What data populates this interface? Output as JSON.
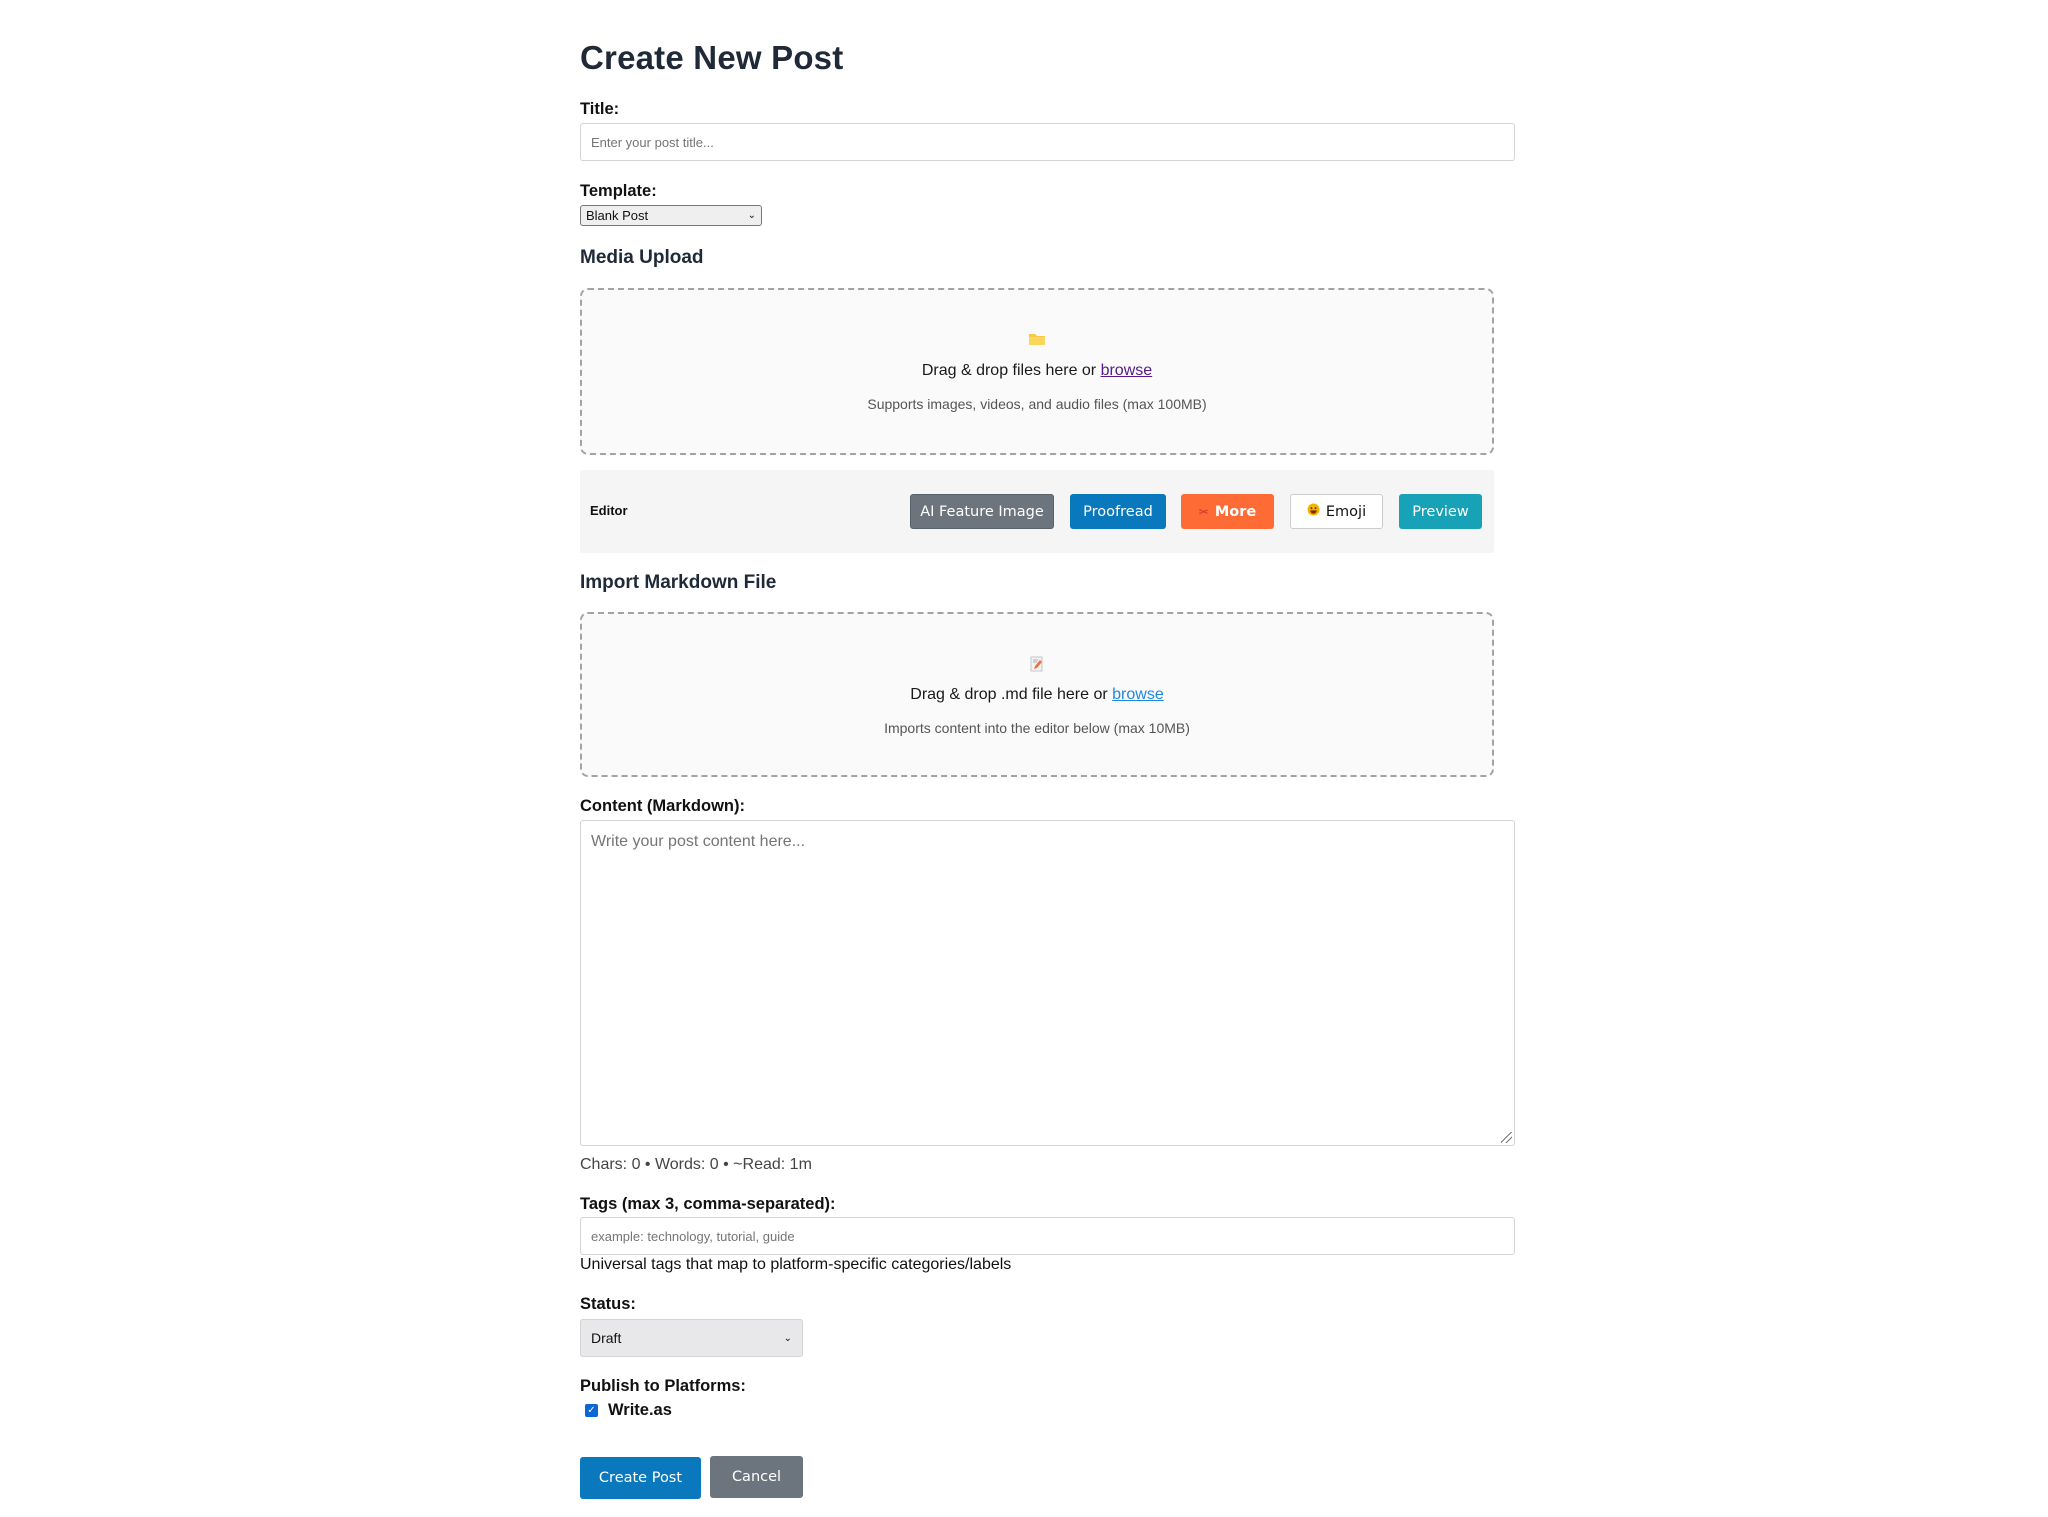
{
  "page_title": "Create New Post",
  "title_field": {
    "label": "Title:",
    "placeholder": "Enter your post title..."
  },
  "template": {
    "label": "Template:",
    "selected": "Blank Post"
  },
  "media_upload": {
    "heading": "Media Upload",
    "icon": "folder-icon",
    "main_text": "Drag & drop files here or ",
    "link": "browse",
    "hint": "Supports images, videos, and audio files (max 100MB)"
  },
  "editor_toolbar": {
    "label": "Editor",
    "buttons": {
      "ai_feature_image": "AI Feature Image",
      "proofread": "Proofread",
      "more": "More",
      "emoji": "Emoji",
      "preview": "Preview"
    },
    "colors": {
      "ai_feature_image": "#6c757d",
      "proofread": "#0a78bd",
      "more": "#ff6b35",
      "preview": "#17a2b8"
    }
  },
  "import_markdown": {
    "heading": "Import Markdown File",
    "icon": "memo-icon",
    "main_text": "Drag & drop .md file here or ",
    "link": "browse",
    "hint": "Imports content into the editor below (max 10MB)"
  },
  "content": {
    "label": "Content (Markdown):",
    "placeholder": "Write your post content here...",
    "stats": "Chars: 0 • Words: 0 • ~Read: 1m"
  },
  "tags": {
    "label": "Tags (max 3, comma-separated):",
    "placeholder": "example: technology, tutorial, guide",
    "help": "Universal tags that map to platform-specific categories/labels"
  },
  "status": {
    "label": "Status:",
    "selected": "Draft"
  },
  "platforms": {
    "label": "Publish to Platforms:",
    "items": [
      {
        "name": "Write.as",
        "checked": true
      }
    ]
  },
  "actions": {
    "create": "Create Post",
    "cancel": "Cancel"
  }
}
